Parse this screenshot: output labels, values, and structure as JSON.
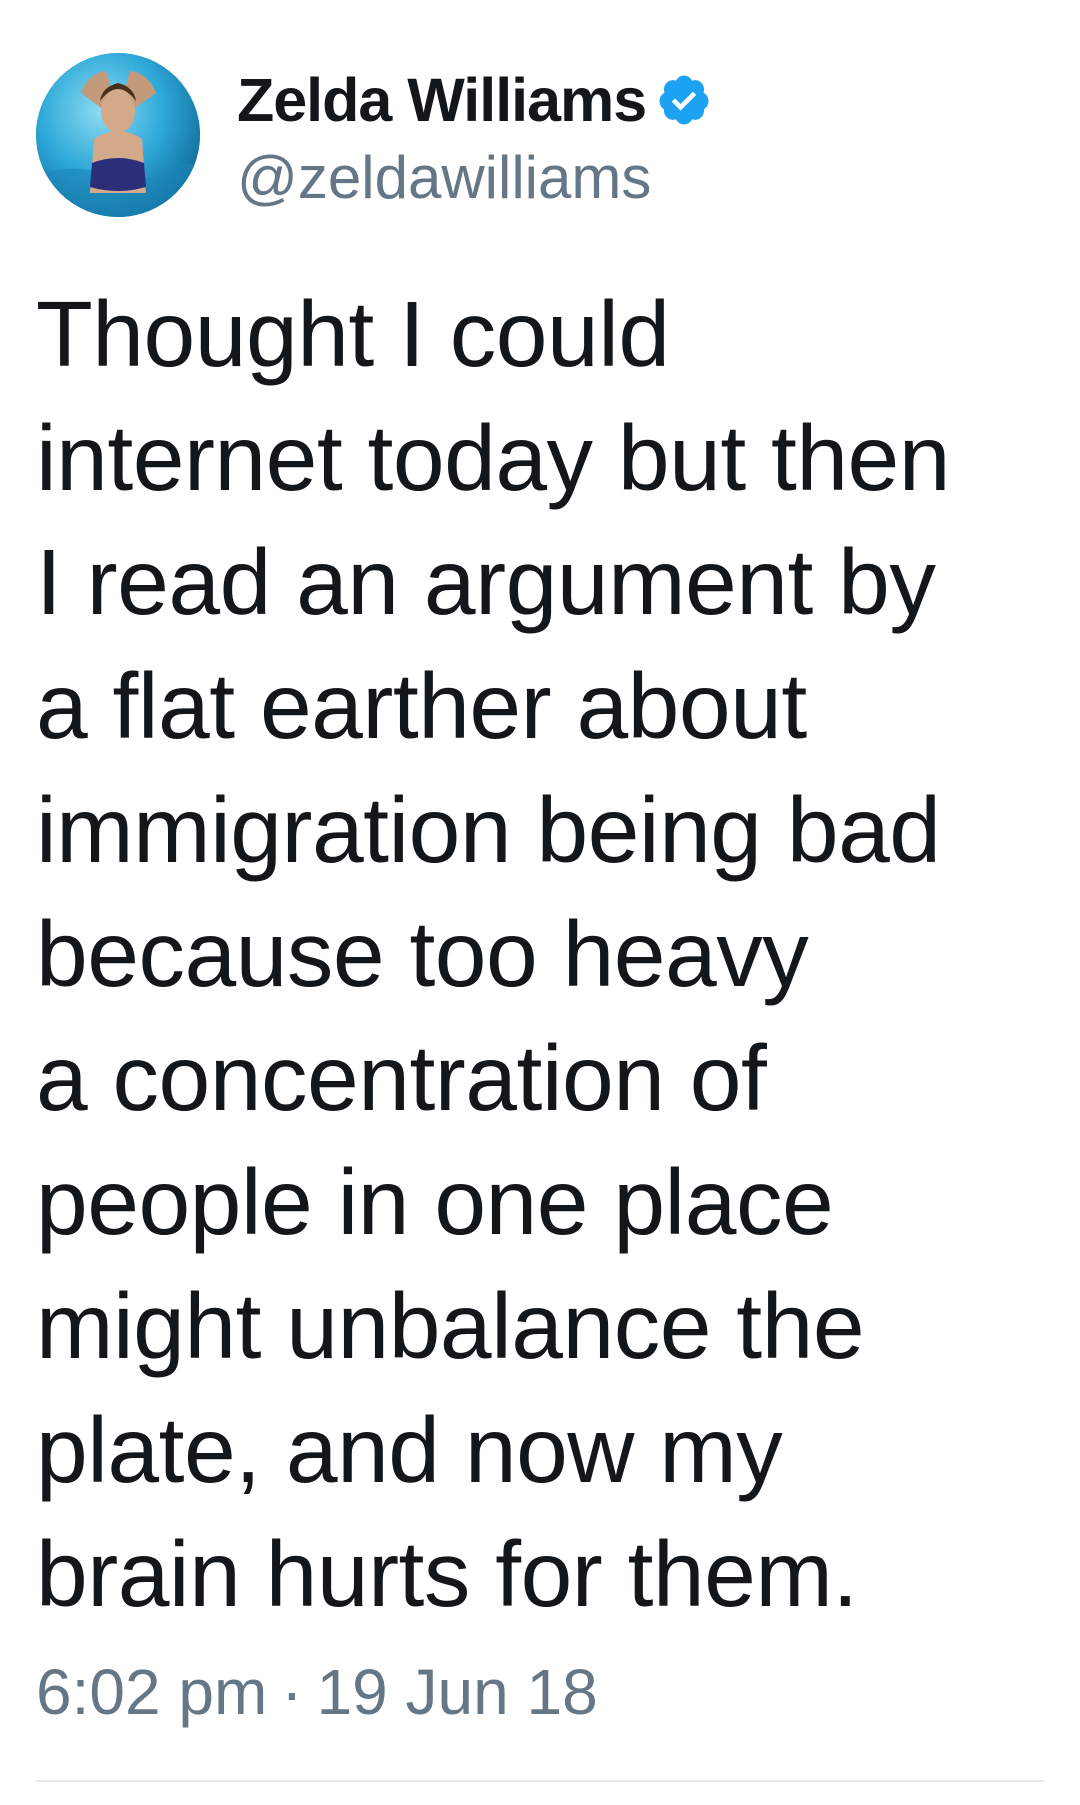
{
  "tweet": {
    "author": {
      "display_name": "Zelda Williams",
      "handle": "@zeldawilliams",
      "verified_icon": "verified-badge-icon",
      "avatar_icon": "profile-photo",
      "verified_color": "#1da1f2"
    },
    "text_lines": [
      "Thought I could",
      "internet today but then",
      "I read an argument by",
      "a flat earther about",
      "immigration being bad",
      "because too heavy",
      "a concentration of",
      "people in one place",
      "might unbalance the",
      "plate, and now my",
      "brain hurts for them."
    ],
    "time": "6:02 pm",
    "separator": "·",
    "date": "19 Jun 18"
  },
  "colors": {
    "text": "#14171a",
    "secondary": "#657786",
    "divider": "#e1e8ed"
  }
}
